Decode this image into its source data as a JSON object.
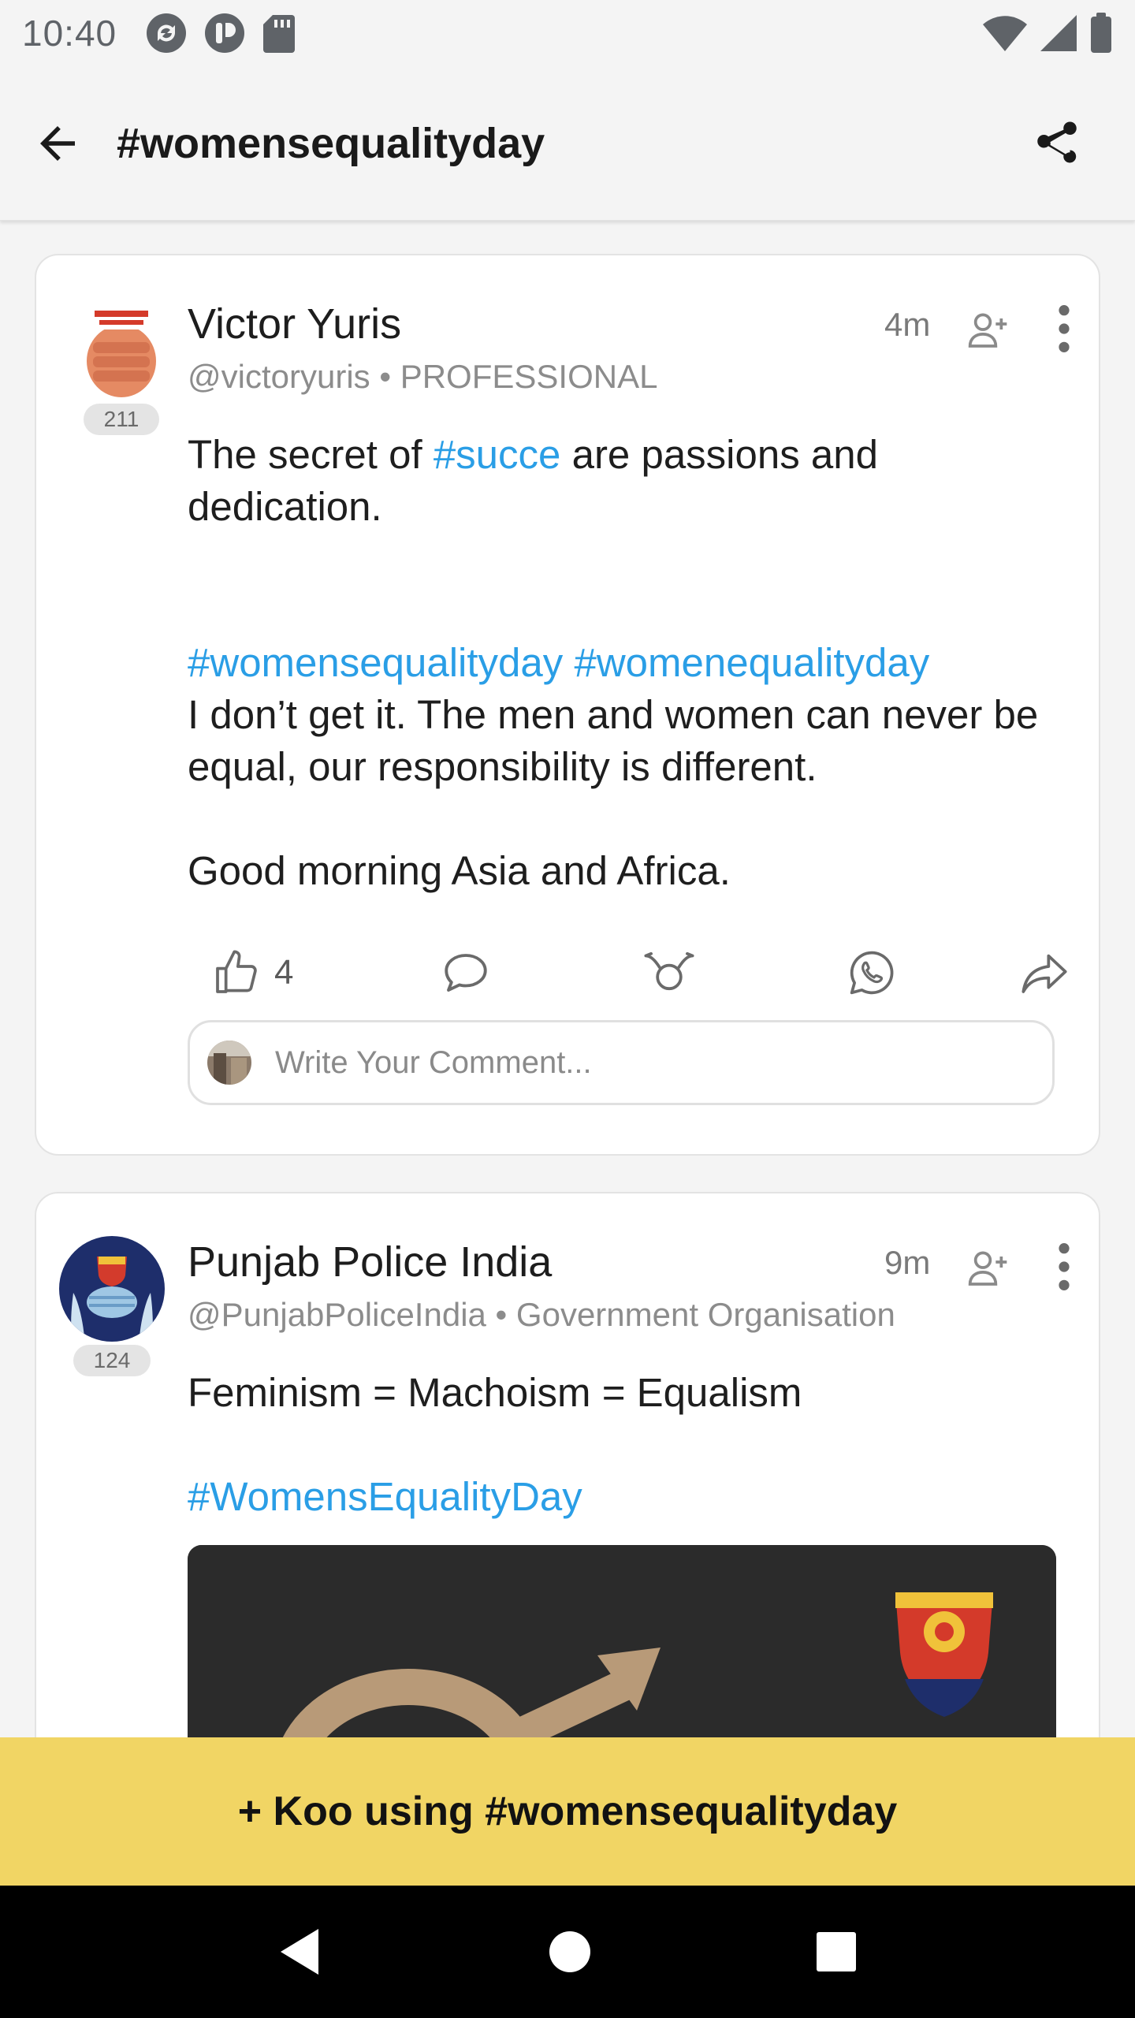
{
  "status_bar": {
    "time": "10:40"
  },
  "header": {
    "title": "#womensequalityday"
  },
  "posts": [
    {
      "author": "Victor Yuris",
      "handle": "@victoryuris",
      "category": "PROFESSIONAL",
      "meta": "@victoryuris • PROFESSIONAL",
      "time": "4m",
      "followers_badge": "211",
      "body": {
        "line1_pre": "The secret of ",
        "line1_tag": "#succe",
        "line1_post": " are passions and dedication.",
        "tag_a": "#womensequalityday",
        "tag_b": "#womenequalityday",
        "para2": "I don’t get it. The men and women can never be equal, our responsibility is different.",
        "para3": "Good morning Asia and Africa."
      },
      "likes": "4",
      "comment_placeholder": "Write Your Comment..."
    },
    {
      "author": "Punjab Police India",
      "meta": "@PunjabPoliceIndia • Government Organisation",
      "time": "9m",
      "followers_badge": "124",
      "body": {
        "line1": "Feminism = Machoism = Equalism",
        "tag": "#WomensEqualityDay"
      }
    }
  ],
  "koo_button": {
    "label": "+ Koo using #womensequalityday"
  },
  "colors": {
    "hashtag": "#2a9ee6",
    "koo_bar": "#f1d564",
    "background": "#f4f4f4"
  }
}
